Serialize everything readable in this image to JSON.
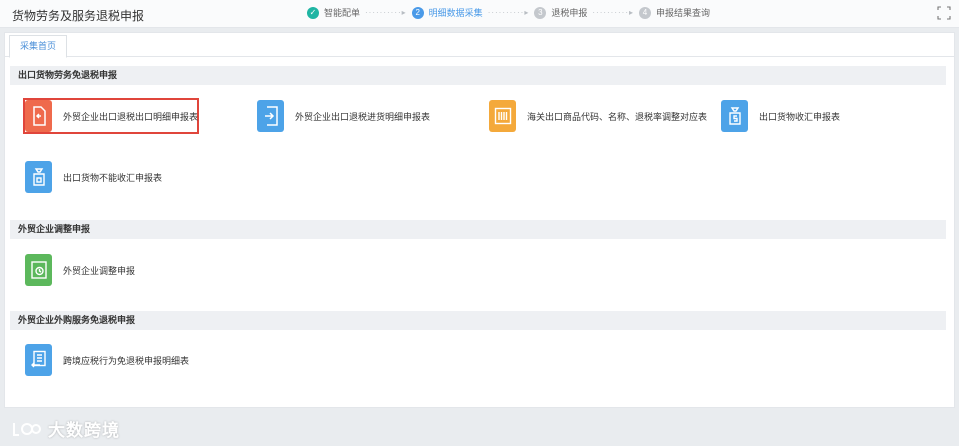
{
  "app": {
    "title": "货物劳务及服务退税申报"
  },
  "steps": [
    {
      "num": "✓",
      "label": "智能配单",
      "state": "done"
    },
    {
      "num": "2",
      "label": "明细数据采集",
      "state": "active"
    },
    {
      "num": "3",
      "label": "退税申报",
      "state": "pending"
    },
    {
      "num": "4",
      "label": "申报结果查询",
      "state": "pending"
    }
  ],
  "step_separator": "··········▸",
  "tabs": [
    {
      "label": "采集首页"
    }
  ],
  "sections": [
    {
      "title": "出口货物劳务免退税申报",
      "items": [
        {
          "label": "外贸企业出口退税出口明细申报表",
          "icon": "export-doc-icon",
          "color": "#ef6a4c",
          "selected": true
        },
        {
          "label": "外贸企业出口退税进货明细申报表",
          "icon": "import-doc-icon",
          "color": "#4da3e8"
        },
        {
          "label": "海关出口商品代码、名称、退税率调整对应表",
          "icon": "barcode-icon",
          "color": "#f4a93b"
        },
        {
          "label": "出口货物收汇申报表",
          "icon": "money-bag-icon",
          "color": "#4da3e8"
        },
        {
          "label": "出口货物不能收汇申报表",
          "icon": "lock-bag-icon",
          "color": "#4da3e8"
        }
      ]
    },
    {
      "title": "外贸企业调整申报",
      "items": [
        {
          "label": "外贸企业调整申报",
          "icon": "adjust-doc-icon",
          "color": "#5cb85c"
        }
      ]
    },
    {
      "title": "外贸企业外购服务免退税申报",
      "items": [
        {
          "label": "跨境应税行为免退税申报明细表",
          "icon": "list-doc-icon",
          "color": "#4da3e8"
        }
      ]
    }
  ],
  "watermark": {
    "text": "大数跨境"
  }
}
